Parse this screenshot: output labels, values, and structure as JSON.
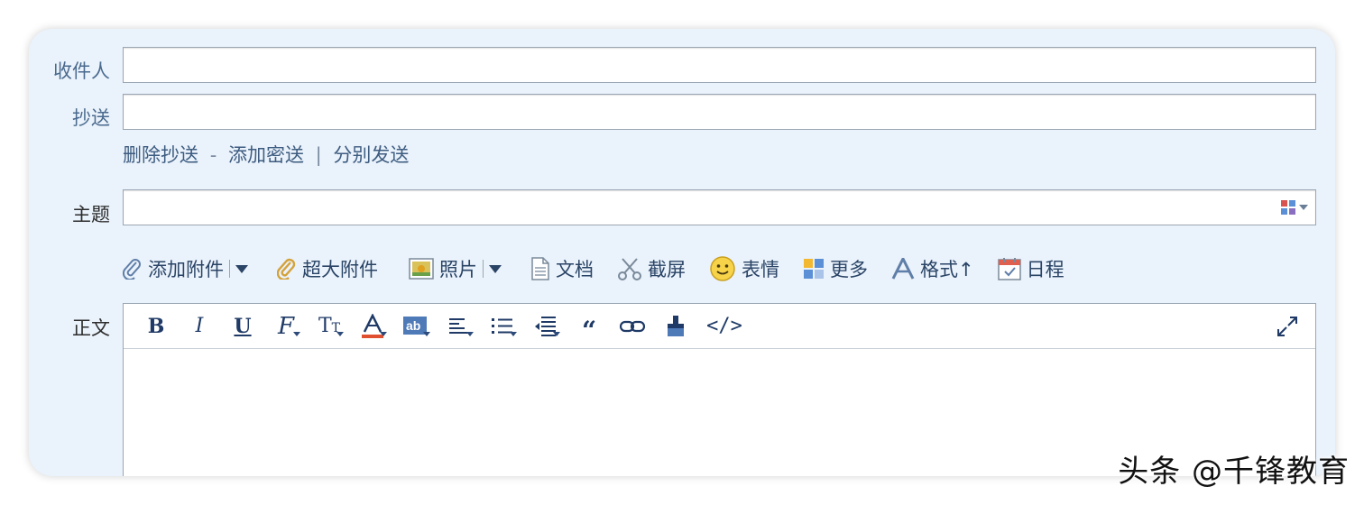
{
  "labels": {
    "to": "收件人",
    "cc": "抄送",
    "subject": "主题",
    "body": "正文"
  },
  "fields": {
    "to_value": "",
    "cc_value": "",
    "subject_value": ""
  },
  "cc_links": {
    "remove_cc": "删除抄送",
    "sep1": "-",
    "add_bcc": "添加密送",
    "sep2": "|",
    "send_separately": "分别发送"
  },
  "attach_bar": {
    "add_attachment": "添加附件",
    "large_attachment": "超大附件",
    "photo": "照片",
    "document": "文档",
    "screenshot": "截屏",
    "emoji": "表情",
    "more": "更多",
    "format": "格式↑",
    "schedule": "日程"
  },
  "editor_toolbar": [
    {
      "name": "bold-icon",
      "glyph": "B"
    },
    {
      "name": "italic-icon",
      "glyph": "I"
    },
    {
      "name": "underline-icon",
      "glyph": "U"
    },
    {
      "name": "font-family-icon",
      "glyph": "F"
    },
    {
      "name": "font-size-icon",
      "glyph": "TT"
    },
    {
      "name": "font-color-icon",
      "glyph": "A"
    },
    {
      "name": "highlight-icon",
      "glyph": "ab"
    },
    {
      "name": "align-icon",
      "glyph": ""
    },
    {
      "name": "list-icon",
      "glyph": ""
    },
    {
      "name": "indent-icon",
      "glyph": ""
    },
    {
      "name": "quote-icon",
      "glyph": "❝"
    },
    {
      "name": "link-icon",
      "glyph": ""
    },
    {
      "name": "format-brush-icon",
      "glyph": ""
    },
    {
      "name": "html-source-icon",
      "glyph": "</>"
    }
  ],
  "watermark": "头条 @千锋教育",
  "colors": {
    "panel_bg": "#eaf2fb",
    "link_color": "#3d5c80",
    "icon_color": "#2c4a7a"
  }
}
